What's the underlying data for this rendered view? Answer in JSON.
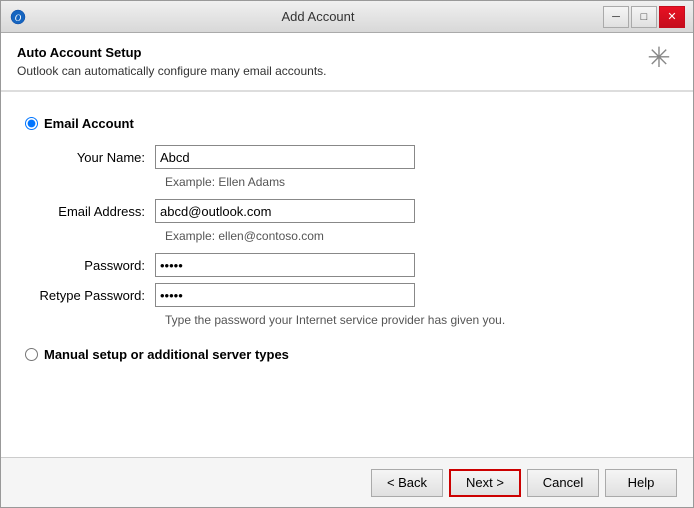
{
  "window": {
    "title": "Add Account",
    "icon": "outlook-icon"
  },
  "titlebar": {
    "minimize_label": "─",
    "maximize_label": "□",
    "close_label": "✕"
  },
  "auto_setup": {
    "heading": "Auto Account Setup",
    "description": "Outlook can automatically configure many email accounts."
  },
  "form": {
    "email_account_label": "Email Account",
    "your_name_label": "Your Name:",
    "your_name_value": "Abcd",
    "your_name_hint": "Example: Ellen Adams",
    "email_address_label": "Email Address:",
    "email_address_value": "abcd@outlook.com",
    "email_address_hint": "Example: ellen@contoso.com",
    "password_label": "Password:",
    "password_value": "*****",
    "retype_password_label": "Retype Password:",
    "retype_password_value": "*****",
    "password_hint": "Type the password your Internet service provider has given you.",
    "manual_setup_label": "Manual setup or additional server types"
  },
  "footer": {
    "back_label": "< Back",
    "next_label": "Next >",
    "cancel_label": "Cancel",
    "help_label": "Help"
  }
}
